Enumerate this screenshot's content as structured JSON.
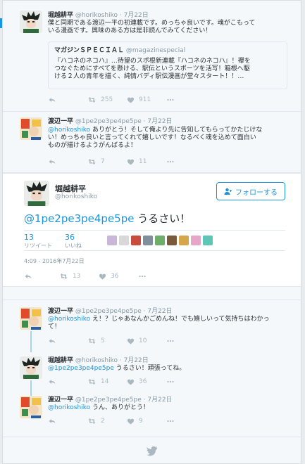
{
  "tweets": {
    "t1": {
      "name": "堀越耕平",
      "handle": "@horikoshiko",
      "time": "· 7月22日",
      "text_1": "僕と同期である渡辺一平の初連載です。めっちゃ良いです。魂がこもって",
      "text_2": "いる漫画です。興味のある方は是非読んでみてください！",
      "quote": {
        "name": "マガジンＳＰＥＣＩＡＬ",
        "handle": "@magazinespecial",
        "text_1": "『ハコネのネコハ』…待望のスポ根新連載『ハコネのネコハ』！襷を",
        "text_2": "つなぐためにすべてを懸ける、駅伝というスポーツを活写！箱根へ駆",
        "text_3": "ける２人の青年を描く、純情バディ駅伝漫画が堂々スタート！！…"
      },
      "retweets": "255",
      "likes": "911"
    },
    "t2": {
      "name": "渡辺一平",
      "handle": "@1pe2pe3pe4pe5pe",
      "time": "· 7月22日",
      "mention": "@horikoshiko",
      "text_1": " ありがとう！そして俺より先に告知してもらってかたじけな",
      "text_2": "い！めっちゃ良いと言ってくれて嬉しいです！なるべく魂を込めて面白い",
      "text_3": "ものが描けるようがんばるよ！",
      "retweets": "7",
      "likes": "11"
    },
    "main": {
      "name": "堀越耕平",
      "handle": "@horikoshiko",
      "follow_label": "フォローする",
      "mention": "@1pe2pe3pe4pe5pe",
      "text": " うるさい！",
      "retweets": "13",
      "retweets_label": "リツイート",
      "likes": "36",
      "likes_label": "いいね",
      "timestamp": "4:09 - 2016年7月22日",
      "action_retweets": "13",
      "action_likes": "36"
    },
    "r1": {
      "name": "渡辺一平",
      "handle": "@1pe2pe3pe4pe5pe",
      "time": "· 7月22日",
      "mention": "@horikoshiko",
      "text_1": " え！？じゃあなんかごめんね！でも嬉しいって気持ちはわかっ",
      "text_2": "て！",
      "retweets": "5",
      "likes": "10"
    },
    "r2": {
      "name": "堀越耕平",
      "handle": "@horikoshiko",
      "time": "· 7月22日",
      "mention": "@1pe2pe3pe4pe5pe",
      "text": " うるさい！頑張ってね。",
      "retweets": "14",
      "likes": "36"
    },
    "r3": {
      "name": "渡辺一平",
      "handle": "@1pe2pe3pe4pe5pe",
      "time": "· 7月22日",
      "mention": "@horikoshiko",
      "text": " うん、ありがとう！",
      "retweets": "2",
      "likes": "9"
    }
  },
  "icons": {
    "reply": "reply-icon",
    "retweet": "retweet-icon",
    "like": "heart-icon",
    "more": "more-icon",
    "follow": "person-plus-icon",
    "twitter": "twitter-bird-icon"
  },
  "colors": {
    "link": "#1b95e0",
    "muted": "#8899a6",
    "icon": "#aab8c2",
    "background": "#f5f8fa"
  }
}
